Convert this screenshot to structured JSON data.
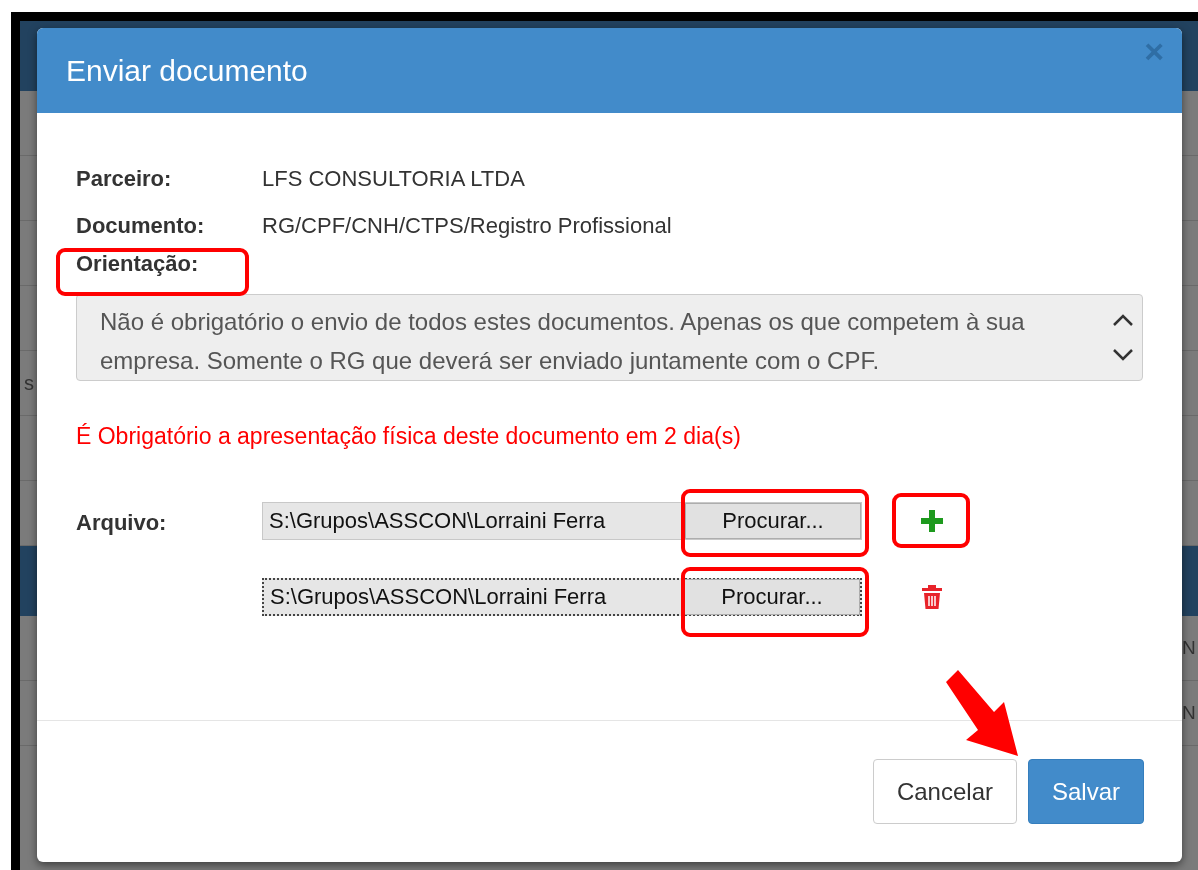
{
  "background_page": {
    "left_cells": [
      "s"
    ],
    "right_cells": [
      "N",
      "N"
    ]
  },
  "dialog": {
    "title": "Enviar documento",
    "close": "×",
    "fields": [
      {
        "label": "Parceiro:",
        "value": "LFS CONSULTORIA LTDA"
      },
      {
        "label": "Documento:",
        "value": "RG/CPF/CNH/CTPS/Registro Profissional"
      }
    ],
    "orientation_label": "Orientação:",
    "orientation_text": "Não é obrigatório o envio de todos estes documentos. Apenas os que competem à sua empresa. Somente o RG que deverá ser enviado juntamente com o CPF.",
    "warning": "É Obrigatório a apresentação física deste documento em 2 dia(s)",
    "file_label": "Arquivo:",
    "files": [
      {
        "path": "S:\\Grupos\\ASSCON\\Lorraini Ferra",
        "button": "Procurar...",
        "kind": "add",
        "focused": false
      },
      {
        "path": "S:\\Grupos\\ASSCON\\Lorraini Ferra",
        "button": "Procurar...",
        "kind": "remove",
        "focused": true
      }
    ],
    "buttons": [
      {
        "label": "Cancelar",
        "kind": "default"
      },
      {
        "label": "Salvar",
        "kind": "primary"
      }
    ]
  }
}
